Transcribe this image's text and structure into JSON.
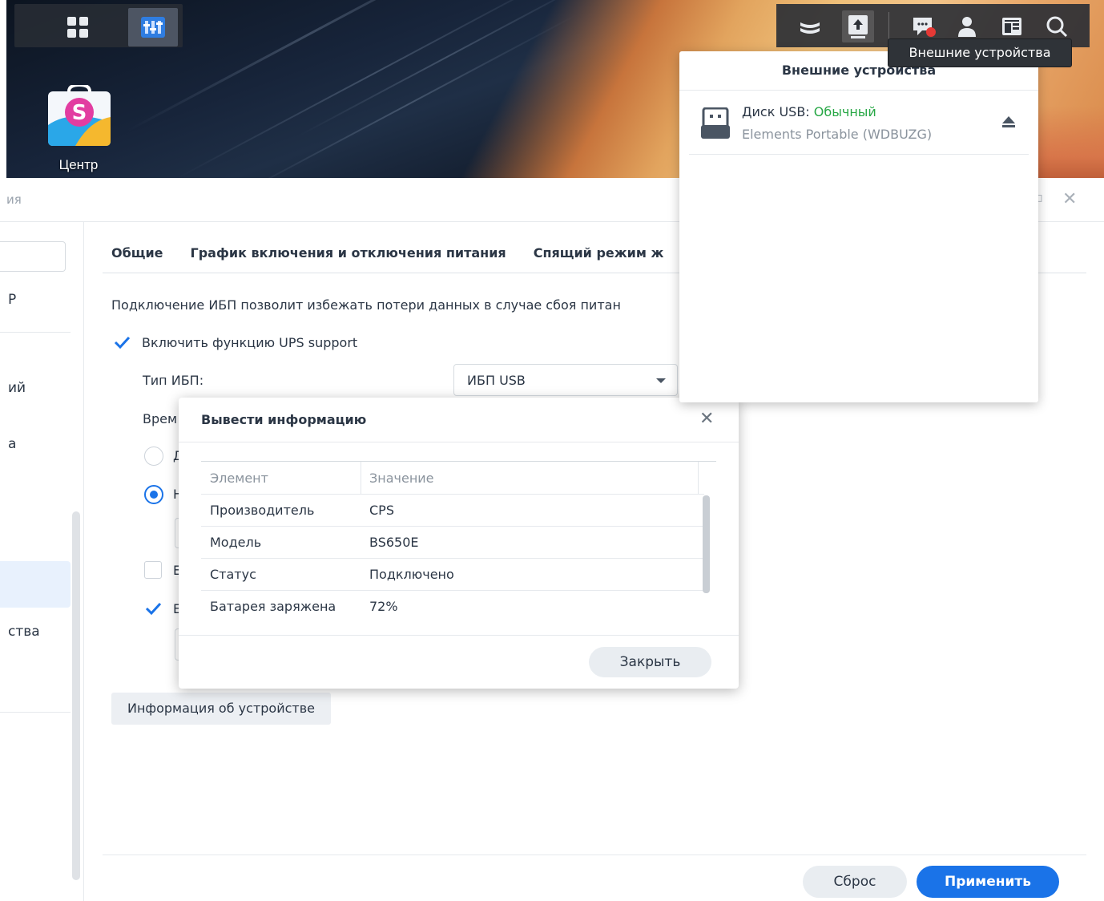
{
  "desktop": {
    "icons": [
      {
        "label": "Центр",
        "icon": "package-center-icon"
      }
    ]
  },
  "taskbar": {
    "left": [
      "apps-grid-icon",
      "control-panel-icon"
    ],
    "tray": [
      "storage-stack-icon",
      "external-devices-icon",
      "notifications-icon",
      "user-icon",
      "widgets-icon",
      "search-icon"
    ]
  },
  "tooltip": {
    "text": "Внешние устройства"
  },
  "external_devices": {
    "title": "Внешние устройства",
    "devices": [
      {
        "name": "Диск USB:",
        "status": "Обычный",
        "model": "Elements Portable (WDBUZG)",
        "icon": "usb-drive-icon"
      }
    ]
  },
  "window": {
    "title_fragment": "ия",
    "sidebar": {
      "items": [
        "Р",
        "ий",
        "а",
        "ства"
      ]
    },
    "tabs": [
      "Общие",
      "График включения и отключения питания",
      "Спящий режим ж"
    ],
    "ups": {
      "description": "Подключение ИБП позволит избежать потери данных в случае сбоя питан",
      "enable_label": "Включить функцию UPS support",
      "type_label": "Тип ИБП:",
      "type_value": "ИБП USB",
      "time_label_fragment": "Врем",
      "radio1_fragment": "Д",
      "radio2_fragment": "Н",
      "check2_fragment": "Е",
      "check3_fragment": "Е",
      "device_info_button": "Информация об устройстве"
    },
    "footer": {
      "reset": "Сброс",
      "apply": "Применить"
    }
  },
  "modal": {
    "title": "Вывести информацию",
    "columns": [
      "Элемент",
      "Значение"
    ],
    "rows": [
      {
        "item": "Производитель",
        "value": "CPS"
      },
      {
        "item": "Модель",
        "value": "BS650E"
      },
      {
        "item": "Статус",
        "value": "Подключено"
      },
      {
        "item": "Батарея заряжена",
        "value": "72%"
      }
    ],
    "close_button": "Закрыть"
  },
  "colors": {
    "accent": "#1a73e8",
    "status_ok": "#27a745"
  }
}
